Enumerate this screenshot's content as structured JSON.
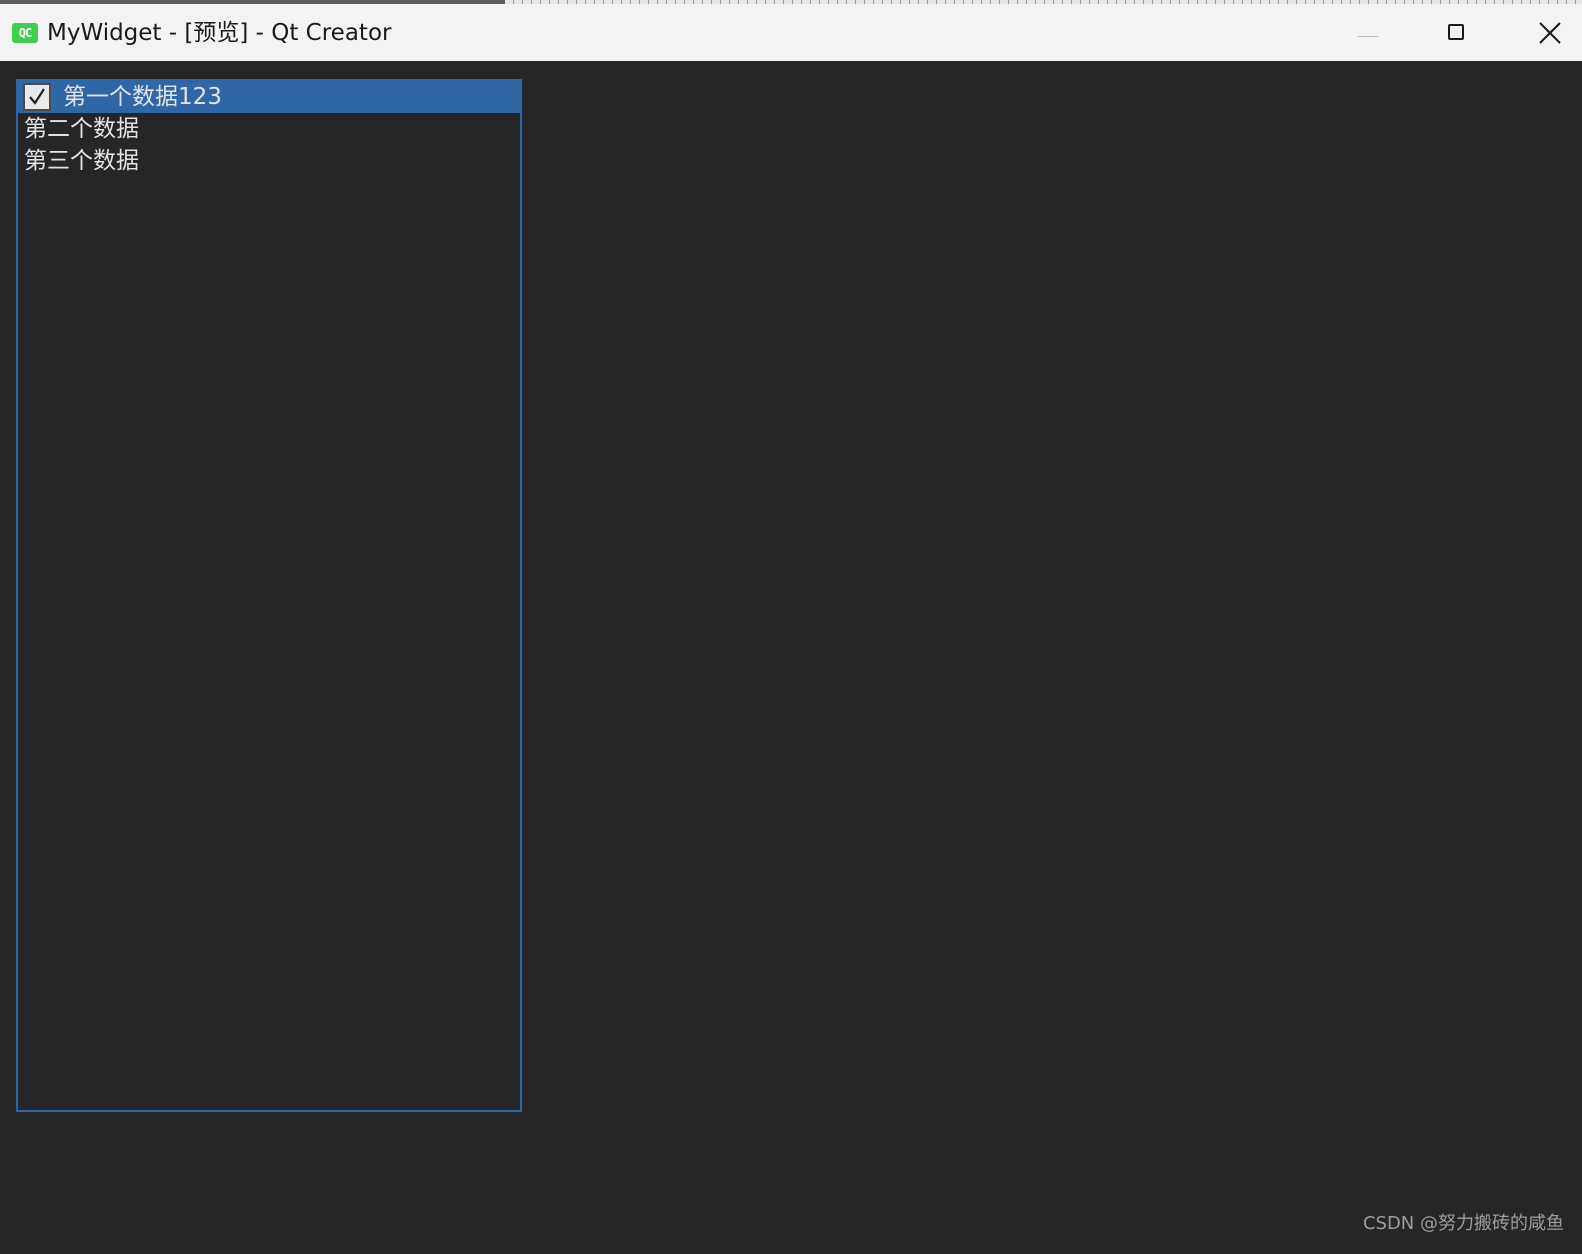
{
  "window": {
    "app_icon_text": "QC",
    "title": "MyWidget - [预览] - Qt Creator",
    "minimize_icon": "minimize-icon",
    "maximize_icon": "maximize-icon",
    "close_icon": "close-icon"
  },
  "list": {
    "items": [
      {
        "label": "第一个数据123",
        "checked": true,
        "selected": true
      },
      {
        "label": "第二个数据",
        "checked": false,
        "selected": false
      },
      {
        "label": "第三个数据",
        "checked": false,
        "selected": false
      }
    ]
  },
  "watermark": "CSDN @努力搬砖的咸鱼",
  "colors": {
    "background": "#252627",
    "selection": "#2e66a6",
    "list_border": "#2f65a5",
    "titlebar": "#f3f3f3",
    "qt_green": "#41cd52"
  }
}
